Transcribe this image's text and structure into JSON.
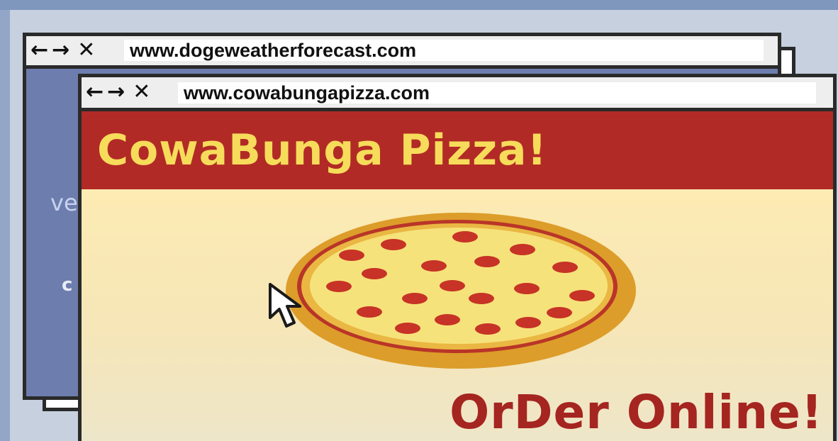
{
  "back_browser": {
    "nav_back": "←",
    "nav_forward": "→",
    "nav_close": "✕",
    "url": "www.dogeweatherforecast.com",
    "partial_text_1": "ve",
    "partial_text_2": "c"
  },
  "front_browser": {
    "nav_back": "←",
    "nav_forward": "→",
    "nav_close": "✕",
    "url": "www.cowabungapizza.com",
    "site_title": "CowaBunga Pizza!",
    "cta": "OrDer Online!"
  },
  "colors": {
    "header_red": "#b22a26",
    "title_yellow": "#f6dc5a",
    "cta_red": "#a52520",
    "page_cream": "#fbe9ad",
    "back_blue": "#6d7dad"
  },
  "icons": [
    "arrow-back-icon",
    "arrow-forward-icon",
    "close-icon",
    "pizza-image",
    "mouse-cursor-icon"
  ]
}
